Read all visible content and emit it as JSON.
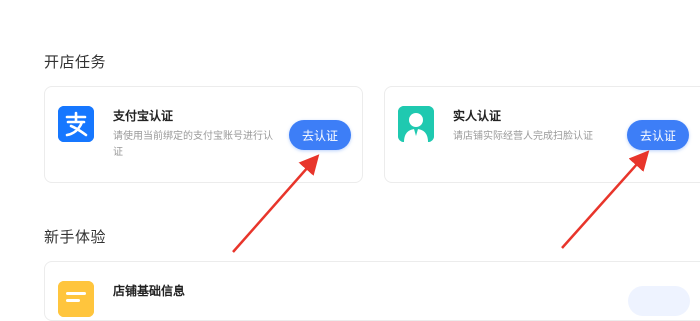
{
  "sections": {
    "shop_tasks": "开店任务",
    "newbie": "新手体验"
  },
  "cards": {
    "alipay": {
      "title": "支付宝认证",
      "desc": "请使用当前绑定的支付宝账号进行认证",
      "button": "去认证",
      "icon": "alipay-icon"
    },
    "real_name": {
      "title": "实人认证",
      "desc": "请店铺实际经营人完成扫脸认证",
      "button": "去认证",
      "icon": "person-icon"
    },
    "store_info": {
      "title": "店铺基础信息",
      "icon": "document-icon"
    }
  },
  "colors": {
    "accent": "#3d7ef7",
    "alipay_blue": "#1677ff",
    "person_teal": "#1fc9b0",
    "store_yellow": "#ffc53d",
    "arrow_red": "#e8352b"
  }
}
